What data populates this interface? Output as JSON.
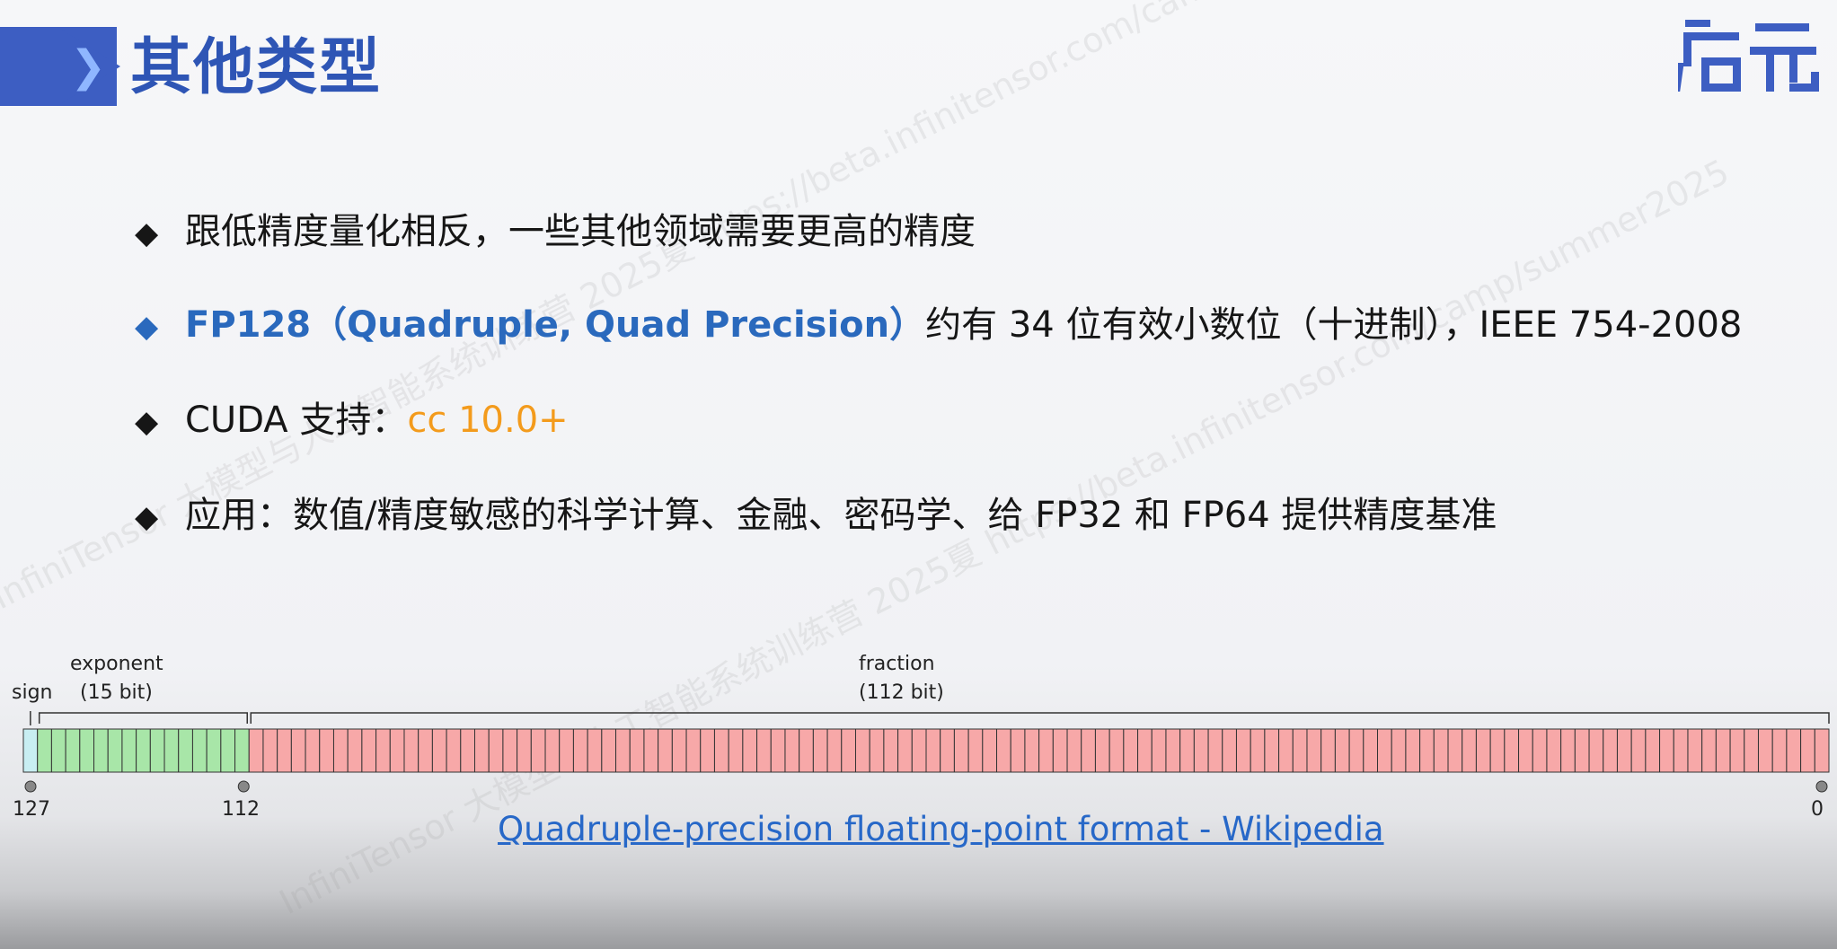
{
  "header": {
    "title": "其他类型",
    "logo_text": "启元"
  },
  "bullets": [
    {
      "marker": "◆",
      "text": "跟低精度量化相反，一些其他领域需要更高的精度"
    },
    {
      "marker": "◆",
      "highlight": "FP128（Quadruple, Quad Precision）",
      "text": "约有 34 位有效小数位（十进制），IEEE 754-2008"
    },
    {
      "marker": "◆",
      "text": "CUDA 支持：",
      "highlight": "cc 10.0+"
    },
    {
      "marker": "◆",
      "text": "应用：数值/精度敏感的科学计算、金融、密码学、给 FP32 和 FP64 提供精度基准"
    }
  ],
  "diagram": {
    "sign_label": "sign",
    "exponent_label": "exponent",
    "exponent_bits": "(15 bit)",
    "fraction_label": "fraction",
    "fraction_bits": "(112 bit)",
    "bit_127": "127",
    "bit_112": "112",
    "bit_0": "0",
    "sign_count": 1,
    "exponent_count": 15,
    "fraction_count": 112,
    "colors": {
      "sign": "#c8eef2",
      "exponent": "#a8e6a8",
      "fraction": "#f7a8a8"
    }
  },
  "link": {
    "text": "Quadruple-precision floating-point format - Wikipedia"
  },
  "watermark": {
    "text_1": "InfiniTensor 大模型与人工智能系统训练营 2025夏 https://beta.infinitensor.com/camp/summer2025",
    "text_2": "InfiniTensor 大模型与人工智能系统训练营 2025夏 https://beta.infinitensor.com/camp/summer2025"
  }
}
